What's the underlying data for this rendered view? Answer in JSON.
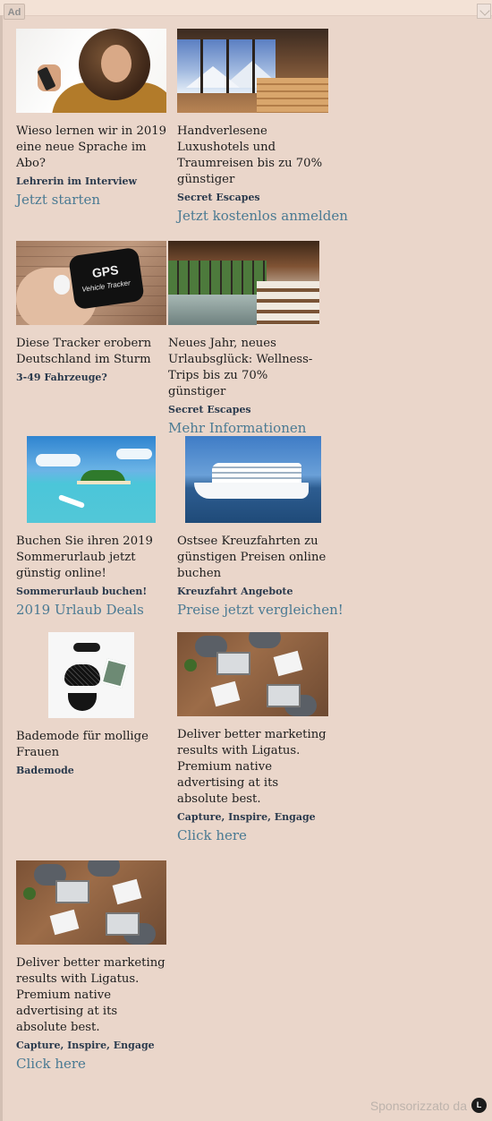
{
  "header": {
    "ad_badge": "Ad"
  },
  "cards": [
    {
      "title": "Wieso lernen wir in 2019 eine neue Sprache im Abo?",
      "source": "Lehrerin im Interview",
      "cta": "Jetzt starten"
    },
    {
      "title": "Handverlesene Luxushotels und Traumreisen bis zu 70% günstiger",
      "source": "Secret Escapes",
      "cta": "Jetzt kostenlos anmelden"
    },
    {
      "title": "Diese Tracker erobern Deutschland im Sturm",
      "source": "3-49 Fahrzeuge?",
      "cta": "",
      "image_text_1": "GPS",
      "image_text_2": "Vehicle Tracker"
    },
    {
      "title": "Neues Jahr, neues Urlaubsglück: Wellness-Trips bis zu 70% günstiger",
      "source": "Secret Escapes",
      "cta": "Mehr Informationen"
    },
    {
      "title": "Buchen Sie ihren 2019 Sommerurlaub jetzt günstig online!",
      "source": "Sommerurlaub buchen!",
      "cta": "2019 Urlaub Deals"
    },
    {
      "title": "Ostsee Kreuzfahrten zu günstigen Preisen online buchen",
      "source": "Kreuzfahrt Angebote",
      "cta": "Preise jetzt vergleichen!"
    },
    {
      "title": "Bademode für mollige Frauen",
      "source": "Bademode",
      "cta": ""
    },
    {
      "title": "Deliver better marketing results with Ligatus. Premium native advertising at its absolute best.",
      "source": "Capture, Inspire, Engage",
      "cta": "Click here"
    },
    {
      "title": "Deliver better marketing results with Ligatus. Premium native advertising at its absolute best.",
      "source": "Capture, Inspire, Engage",
      "cta": "Click here"
    }
  ],
  "footer": {
    "text": "Sponsorizzato da",
    "logo_letter": "L"
  }
}
